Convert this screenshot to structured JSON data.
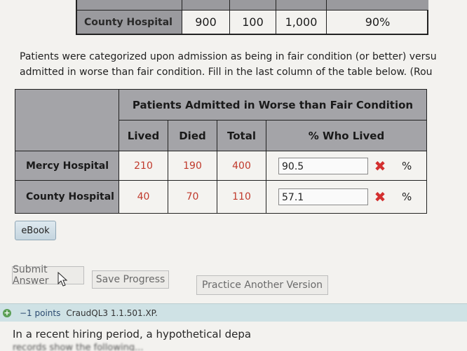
{
  "prev_table": {
    "row_label": "County Hospital",
    "cells": [
      "900",
      "100",
      "1,000",
      "90%"
    ]
  },
  "question": {
    "line1": "Patients were categorized upon admission as being in fair condition (or better) versu",
    "line2": "admitted in worse than fair condition. Fill in the last column of the table below. (Rou"
  },
  "table": {
    "group_header": "Patients Admitted in Worse than Fair Condition",
    "columns": [
      "Lived",
      "Died",
      "Total",
      "% Who Lived"
    ],
    "rows": [
      {
        "label": "Mercy Hospital",
        "lived": "210",
        "died": "190",
        "total": "400",
        "answer": "90.5",
        "unit": "%"
      },
      {
        "label": "County Hospital",
        "lived": "40",
        "died": "70",
        "total": "110",
        "answer": "57.1",
        "unit": "%"
      }
    ],
    "status_icon": "x-mark-icon",
    "status_color": "#d32f2f",
    "value_color": "#c0392b"
  },
  "buttons": {
    "ebook": "eBook",
    "submit": "Submit Answer",
    "save": "Save Progress",
    "practice": "Practice Another Version"
  },
  "next_question": {
    "points": "−1 points",
    "code": "CraudQL3 1.1.501.XP.",
    "text": "In a recent hiring period, a hypothetical depa",
    "text2": "records show the following..."
  }
}
